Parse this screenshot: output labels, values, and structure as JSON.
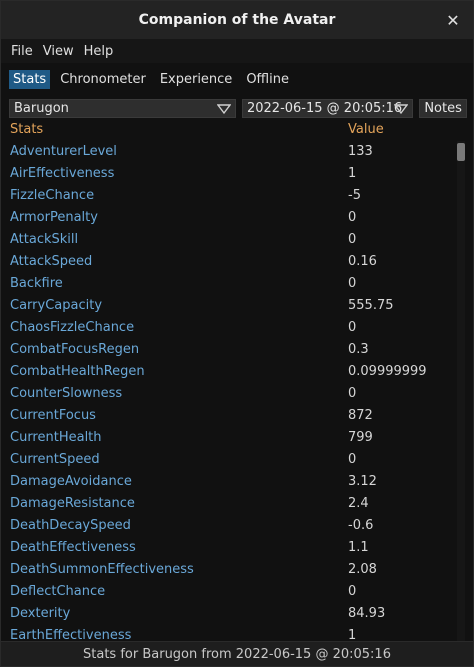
{
  "window": {
    "title": "Companion of the Avatar",
    "close_glyph": "✕"
  },
  "menu": {
    "items": [
      "File",
      "View",
      "Help"
    ]
  },
  "tabs": [
    {
      "label": "Stats",
      "active": true
    },
    {
      "label": "Chronometer",
      "active": false
    },
    {
      "label": "Experience",
      "active": false
    },
    {
      "label": "Offline",
      "active": false
    }
  ],
  "controls": {
    "character": "Barugon",
    "date": "2022-06-15 @ 20:05:16",
    "notes_label": "Notes"
  },
  "table": {
    "headers": {
      "stat": "Stats",
      "value": "Value"
    },
    "rows": [
      {
        "name": "AdventurerLevel",
        "value": "133"
      },
      {
        "name": "AirEffectiveness",
        "value": "1"
      },
      {
        "name": "FizzleChance",
        "value": "-5"
      },
      {
        "name": "ArmorPenalty",
        "value": "0"
      },
      {
        "name": "AttackSkill",
        "value": "0"
      },
      {
        "name": "AttackSpeed",
        "value": "0.16"
      },
      {
        "name": "Backfire",
        "value": "0"
      },
      {
        "name": "CarryCapacity",
        "value": "555.75"
      },
      {
        "name": "ChaosFizzleChance",
        "value": "0"
      },
      {
        "name": "CombatFocusRegen",
        "value": "0.3"
      },
      {
        "name": "CombatHealthRegen",
        "value": "0.09999999"
      },
      {
        "name": "CounterSlowness",
        "value": "0"
      },
      {
        "name": "CurrentFocus",
        "value": "872"
      },
      {
        "name": "CurrentHealth",
        "value": "799"
      },
      {
        "name": "CurrentSpeed",
        "value": "0"
      },
      {
        "name": "DamageAvoidance",
        "value": "3.12"
      },
      {
        "name": "DamageResistance",
        "value": "2.4"
      },
      {
        "name": "DeathDecaySpeed",
        "value": "-0.6"
      },
      {
        "name": "DeathEffectiveness",
        "value": "1.1"
      },
      {
        "name": "DeathSummonEffectiveness",
        "value": "2.08"
      },
      {
        "name": "DeflectChance",
        "value": "0"
      },
      {
        "name": "Dexterity",
        "value": "84.93"
      },
      {
        "name": "EarthEffectiveness",
        "value": "1"
      }
    ]
  },
  "status": {
    "text": "Stats for Barugon from 2022-06-15 @ 20:05:16"
  },
  "colors": {
    "accent": "#1f5a86",
    "stat_name": "#6aa8d8",
    "header": "#e2a35a"
  }
}
